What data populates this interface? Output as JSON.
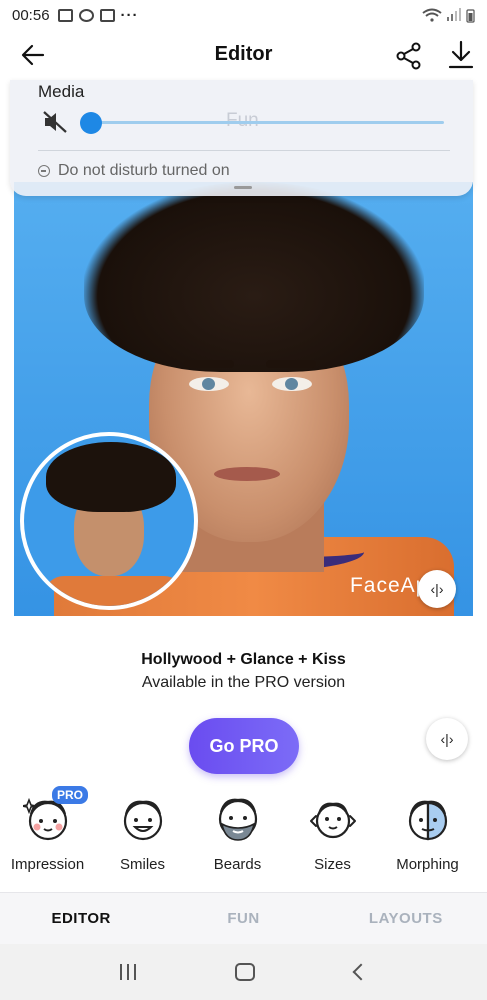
{
  "status_bar": {
    "time": "00:56",
    "overflow": "···"
  },
  "app_bar": {
    "title": "Editor"
  },
  "notification_panel": {
    "media_label": "Media",
    "volume_level": 0.0,
    "ghost_text": "Fun",
    "dnd_text": "Do not disturb turned on"
  },
  "photo": {
    "watermark": "FaceApp"
  },
  "filter": {
    "name": "Hollywood + Glance + Kiss",
    "note": "Available in the PRO version"
  },
  "go_pro": {
    "label": "Go PRO"
  },
  "features": [
    {
      "label": "Impression",
      "badge": "PRO",
      "icon": "impression-icon"
    },
    {
      "label": "Smiles",
      "icon": "smiles-icon"
    },
    {
      "label": "Beards",
      "icon": "beards-icon"
    },
    {
      "label": "Sizes",
      "icon": "sizes-icon"
    },
    {
      "label": "Morphing",
      "icon": "morphing-icon"
    }
  ],
  "tabs": [
    {
      "label": "EDITOR",
      "active": true
    },
    {
      "label": "FUN",
      "active": false
    },
    {
      "label": "LAYOUTS",
      "active": false
    }
  ],
  "colors": {
    "accent": "#6a4cf0",
    "pro_badge": "#3b7ae6",
    "volume": "#1e88e5",
    "photo_bg": "#3d9be9"
  }
}
